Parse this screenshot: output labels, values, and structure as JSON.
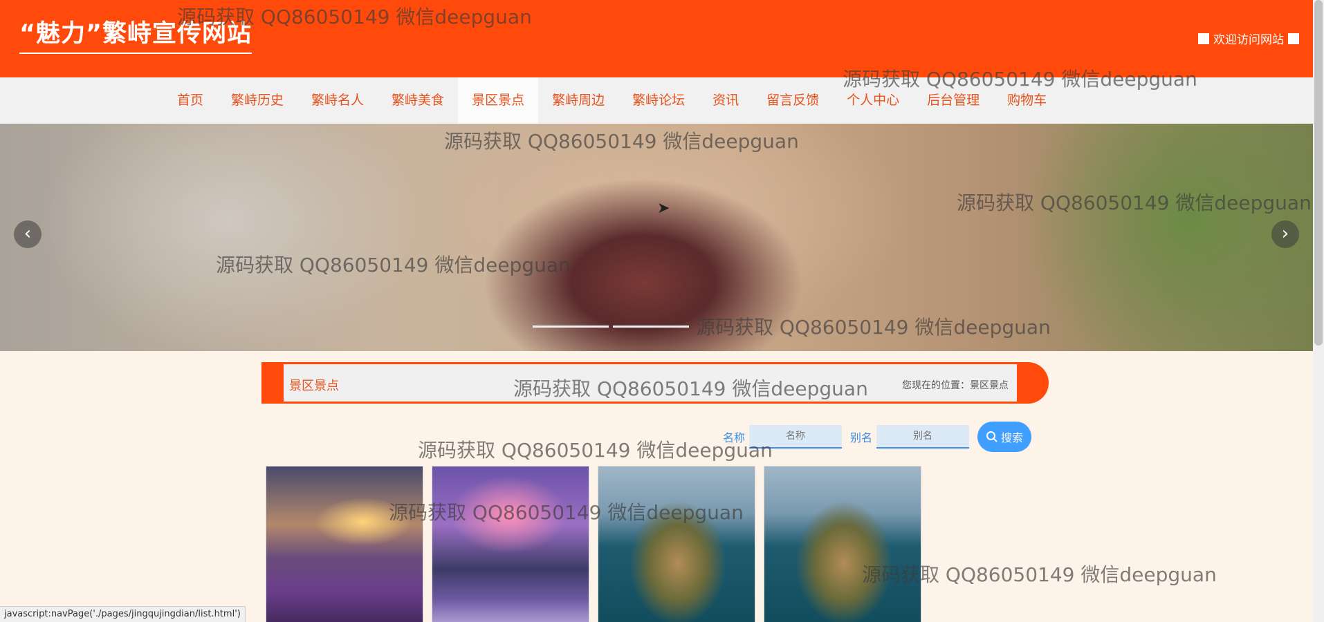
{
  "header": {
    "site_title": "“魅力”繁峙宣传网站",
    "welcome_text": "欢迎访问网站"
  },
  "nav": {
    "items": [
      {
        "label": "首页"
      },
      {
        "label": "繁峙历史"
      },
      {
        "label": "繁峙名人"
      },
      {
        "label": "繁峙美食"
      },
      {
        "label": "景区景点",
        "active": true
      },
      {
        "label": "繁峙周边"
      },
      {
        "label": "繁峙论坛"
      },
      {
        "label": "资讯"
      },
      {
        "label": "留言反馈"
      },
      {
        "label": "个人中心"
      },
      {
        "label": "后台管理"
      },
      {
        "label": "购物车"
      }
    ]
  },
  "banner": {
    "prev_icon": "‹",
    "next_icon": "›"
  },
  "section": {
    "title": "景区景点",
    "breadcrumb": "您现在的位置：景区景点"
  },
  "search": {
    "name_label": "名称",
    "name_placeholder": "名称",
    "alias_label": "别名",
    "alias_placeholder": "别名",
    "button_label": "搜索"
  },
  "watermark": {
    "text": "源码获取 QQ86050149 微信deepguan"
  },
  "statusbar": {
    "text": "javascript:navPage('./pages/jingqujingdian/list.html')"
  },
  "colors": {
    "header_bg": "#ff4a0b",
    "nav_text": "#e8531d",
    "search_blue": "#409eff",
    "page_bg": "#fdf3e8"
  },
  "icons": {
    "banner_prev": "chevron-left-icon",
    "banner_next": "chevron-right-icon",
    "search": "magnifier-icon"
  }
}
